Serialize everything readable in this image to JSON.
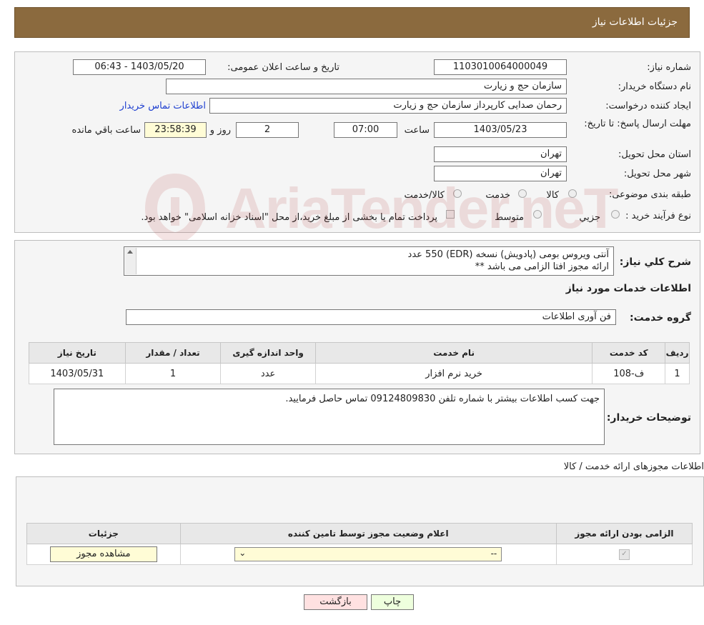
{
  "header": {
    "title": "جزئیات اطلاعات نیاز"
  },
  "info": {
    "need_number_label": "شماره نیاز:",
    "need_number": "1103010064000049",
    "announce_label": "تاریخ و ساعت اعلان عمومی:",
    "announce_value": "1403/05/20 - 06:43",
    "buyer_org_label": "نام دستگاه خریدار:",
    "buyer_org": "سازمان حج و زیارت",
    "creator_label": "ایجاد کننده درخواست:",
    "creator": "رحمان  صدایی کارپرداز سازمان حج و زیارت",
    "contact_link": "اطلاعات تماس خریدار",
    "deadline_label": "مهلت ارسال پاسخ: تا تاریخ:",
    "deadline_date": "1403/05/23",
    "time_label": "ساعت",
    "deadline_time": "07:00",
    "days_value": "2",
    "days_label": "روز و",
    "remaining_value": "23:58:39",
    "remaining_label": "ساعت باقي مانده",
    "province_label": "استان محل تحویل:",
    "province": "تهران",
    "city_label": "شهر محل تحویل:",
    "city": "تهران",
    "category_label": "طبقه بندی موضوعی:",
    "category_options": [
      "کالا",
      "خدمت",
      "کالا/خدمت"
    ],
    "process_label": "نوع فرآیند خرید :",
    "process_options": [
      "جزیي",
      "متوسط"
    ],
    "payment_note": "پرداخت تمام یا بخشی از مبلغ خرید،از محل \"اسناد خزانه اسلامی\" خواهد بود."
  },
  "watermark": {
    "text": "AriaTender.neT"
  },
  "summary": {
    "label": "شرح کلي نیاز:",
    "line1": "آنتی ویروس بومی (پادویش) نسخه (EDR) 550 عدد",
    "line2": "ارائه مجوز افتا الزامی می باشد **",
    "services_title": "اطلاعات خدمات مورد نیاز",
    "group_label": "گروه خدمت:",
    "group_value": "فن آوری اطلاعات"
  },
  "services_table": {
    "headers": [
      "ردیف",
      "کد خدمت",
      "نام خدمت",
      "واحد اندازه گیری",
      "تعداد / مقدار",
      "تاریخ نیاز"
    ],
    "rows": [
      [
        "1",
        "ف-108",
        "خرید نرم افزار",
        "عدد",
        "1",
        "1403/05/31"
      ]
    ]
  },
  "buyer_notes": {
    "label": "توضیحات خریدار:",
    "text": "جهت کسب اطلاعات بیشتر با شماره تلفن 09124809830 تماس حاصل فرمایید."
  },
  "permits": {
    "title": "اطلاعات مجوزهای ارائه خدمت / کالا",
    "headers": [
      "الزامی بودن ارائه مجوز",
      "اعلام وضعیت مجوز توسط تامین کننده",
      "جزئیات"
    ],
    "select_value": "--",
    "view_button": "مشاهده مجوز"
  },
  "buttons": {
    "print": "چاپ",
    "back": "بازگشت"
  },
  "colors": {
    "header_bg": "#8b6a3e",
    "print_bg": "#eeffdd",
    "back_bg": "#ffe1e1",
    "yellow_field": "#fffcd6"
  }
}
